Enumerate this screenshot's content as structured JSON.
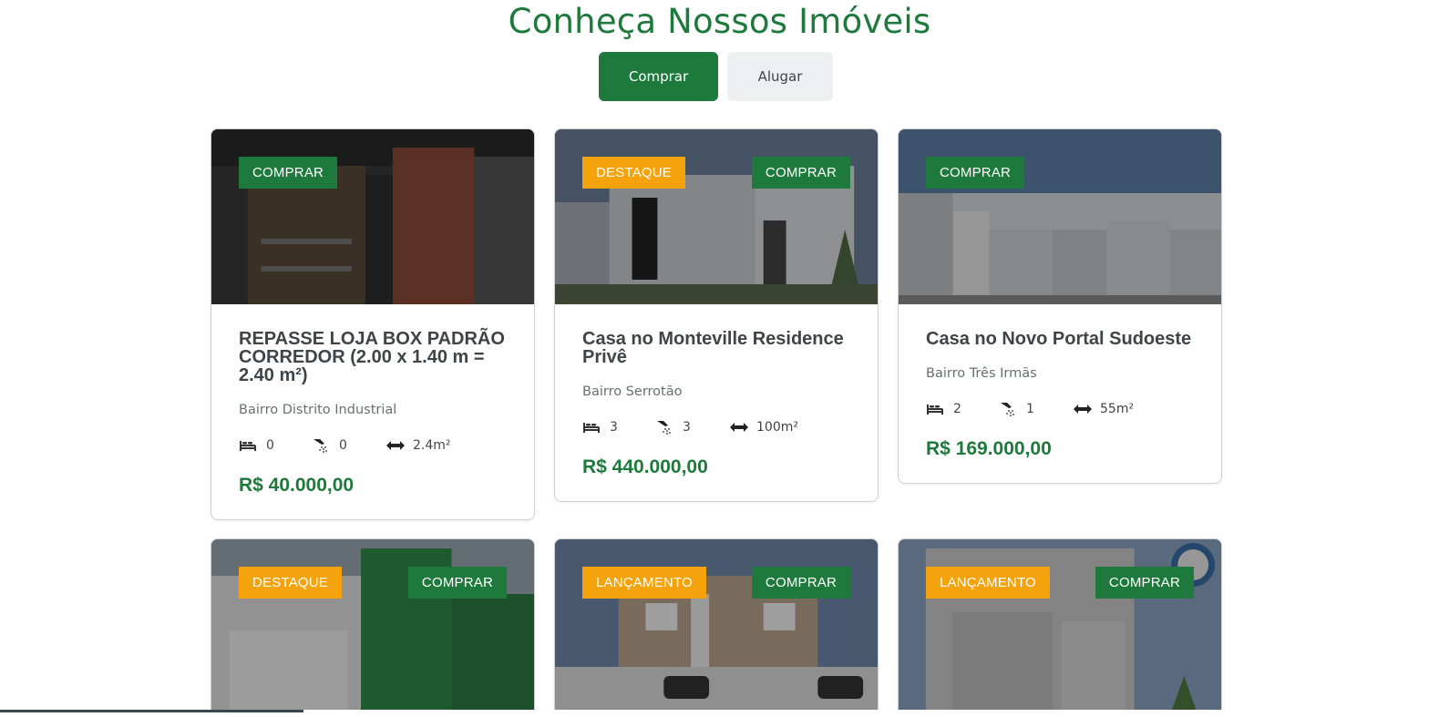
{
  "section": {
    "title": "Conheça Nossos Imóveis"
  },
  "filter": {
    "buy_label": "Comprar",
    "rent_label": "Alugar"
  },
  "colors": {
    "brand_green": "#1e7a3c",
    "badge_orange": "#f5a30c",
    "price_green": "#1e7a3c"
  },
  "icons": {
    "bed": "bed-icon",
    "bath": "shower-icon",
    "area": "area-arrows-icon"
  },
  "listings": [
    {
      "badges": {
        "featured": "",
        "buy": "COMPRAR"
      },
      "title": "REPASSE LOJA BOX PADRÃO CORREDOR (2.00 x 1.40 m = 2.40 m²)",
      "location": "Bairro Distrito Industrial",
      "beds": "0",
      "baths": "0",
      "area": "2.4m²",
      "price": "R$ 40.000,00"
    },
    {
      "badges": {
        "featured": "DESTAQUE",
        "buy": "COMPRAR"
      },
      "title": "Casa no Monteville Residence Privê",
      "location": "Bairro Serrotão",
      "beds": "3",
      "baths": "3",
      "area": "100m²",
      "price": "R$ 440.000,00"
    },
    {
      "badges": {
        "featured": "",
        "buy": "COMPRAR"
      },
      "title": "Casa no Novo Portal Sudoeste",
      "location": "Bairro Três Irmãs",
      "beds": "2",
      "baths": "1",
      "area": "55m²",
      "price": "R$ 169.000,00"
    },
    {
      "badges": {
        "featured": "DESTAQUE",
        "buy": "COMPRAR"
      }
    },
    {
      "badges": {
        "featured": "LANÇAMENTO",
        "buy": "COMPRAR"
      }
    },
    {
      "badges": {
        "featured": "LANÇAMENTO",
        "buy": "COMPRAR"
      }
    }
  ]
}
